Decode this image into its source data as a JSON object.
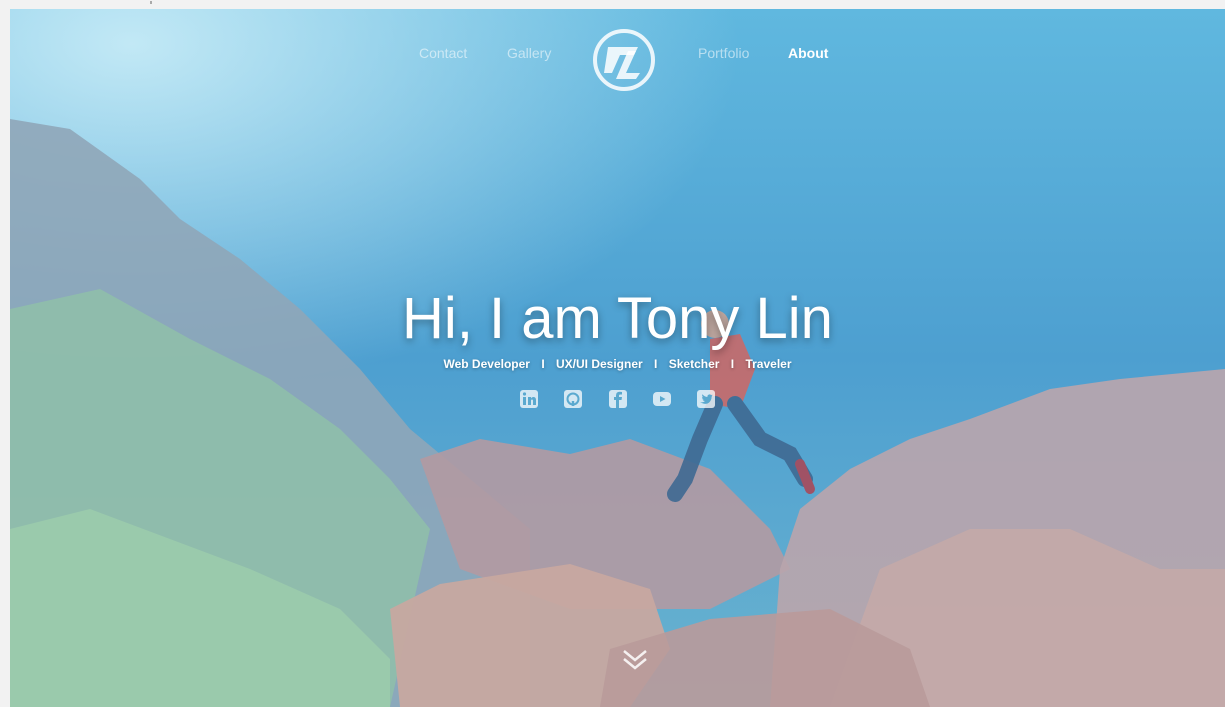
{
  "nav": {
    "items": [
      {
        "label": "Contact"
      },
      {
        "label": "Gallery"
      },
      {
        "label": "Portfolio"
      },
      {
        "label": "About"
      }
    ],
    "active": "About",
    "logo_icon": "tl-monogram-logo"
  },
  "hero": {
    "headline": "Hi, I am Tony Lin",
    "roles": [
      "Web Developer",
      "UX/UI Designer",
      "Sketcher",
      "Traveler"
    ],
    "separator": "I",
    "social_icons": [
      "linkedin-icon",
      "github-icon",
      "facebook-icon",
      "youtube-icon",
      "twitter-icon"
    ],
    "scroll_icon": "chevron-double-down-icon"
  },
  "colors": {
    "sky_tint": "#4fa2d2",
    "text": "#ffffff",
    "rock": "#b99a9a",
    "grass": "#8fc7a5"
  }
}
